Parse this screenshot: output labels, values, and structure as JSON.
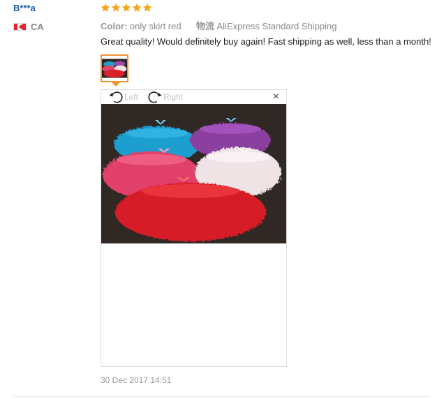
{
  "user": {
    "name": "B***a",
    "country": "CA",
    "flag_icon": "canada-flag-icon"
  },
  "rating": {
    "stars": 5,
    "max": 5,
    "color": "#f7a51c"
  },
  "meta": {
    "color_label": "Color:",
    "color_value": "only skirt red",
    "shipping_label": "物流",
    "shipping_value": "AliExpress Standard Shipping"
  },
  "review": {
    "text": "Great quality! Would definitely buy again! Fast shipping as well, less than a month!"
  },
  "viewer": {
    "rotate_left_label": "Left",
    "rotate_right_label": "Right",
    "close_label": "×"
  },
  "footer": {
    "date": "30 Dec 2017 14:51"
  },
  "colors": {
    "username": "#1d5da8",
    "thumb_border": "#f29331",
    "muted": "#888888"
  }
}
